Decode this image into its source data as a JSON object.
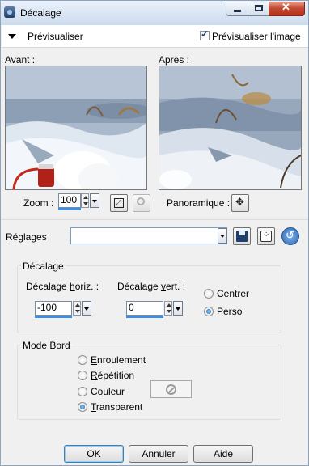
{
  "window": {
    "title": "Décalage",
    "min_glyph": "minimize-icon",
    "max_glyph": "maximize-icon",
    "close_glyph": "✕"
  },
  "preview": {
    "toggle_label": "Prévisualiser",
    "checkbox_label": "Prévisualiser l'image",
    "checkbox_checked": true
  },
  "images": {
    "before_label": "Avant :",
    "after_label": "Après :"
  },
  "zoom": {
    "label": "Zoom :",
    "value": "100",
    "pan_label": "Panoramique :"
  },
  "settings": {
    "label": "Réglages",
    "value": ""
  },
  "offset_group": {
    "title": "Décalage",
    "horiz_label_pre": "Décalage ",
    "horiz_label_ul": "h",
    "horiz_label_post": "oriz. :",
    "vert_label_pre": "Décalage ",
    "vert_label_ul": "v",
    "vert_label_post": "ert. :",
    "horiz_value": "-100",
    "vert_value": "0",
    "center_label": "Centrer",
    "perso_pre": "Per",
    "perso_ul": "s",
    "perso_post": "o",
    "selected": "Perso"
  },
  "edge_group": {
    "title": "Mode Bord",
    "options": [
      {
        "ul": "E",
        "rest": "nroulement"
      },
      {
        "ul": "R",
        "rest": "épétition"
      },
      {
        "ul": "C",
        "rest": "ouleur"
      },
      {
        "ul": "T",
        "rest": "ransparent"
      }
    ],
    "selected": "Transparent"
  },
  "buttons": {
    "ok": "OK",
    "cancel": "Annuler",
    "help": "Aide"
  },
  "colors": {
    "accent": "#3d8ee0",
    "title_bar": "#cddcee",
    "close": "#c24732"
  }
}
